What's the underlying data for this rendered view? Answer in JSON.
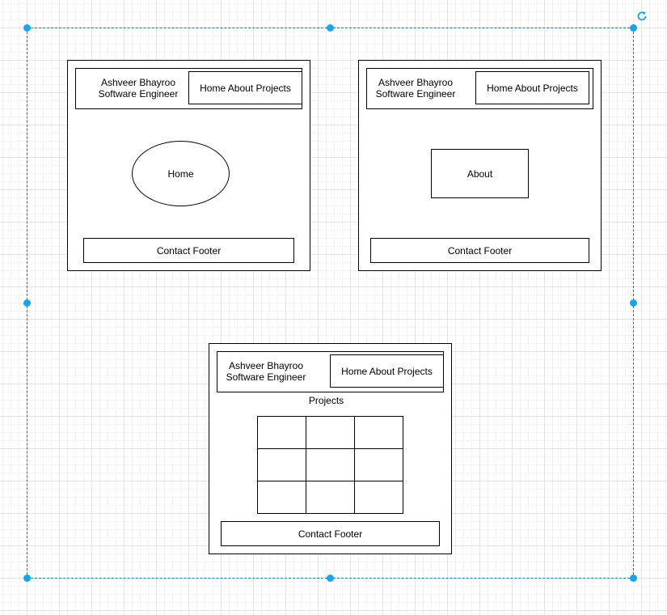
{
  "mockup_home": {
    "header_name": "Ashveer Bhayroo",
    "header_role": "Software Engineer",
    "nav": "Home About Projects",
    "content": "Home",
    "footer": "Contact Footer"
  },
  "mockup_about": {
    "header_name": "Ashveer Bhayroo",
    "header_role": "Software Engineer",
    "nav": "Home About Projects",
    "content": "About",
    "footer": "Contact Footer"
  },
  "mockup_projects": {
    "header_name": "Ashveer Bhayroo",
    "header_role": "Software Engineer",
    "nav": "Home About Projects",
    "content_title": "Projects",
    "grid_rows": 3,
    "grid_cols": 3,
    "footer": "Contact Footer"
  },
  "selection": {
    "color": "#1aa3e8",
    "rotate_icon": "rotate-icon"
  }
}
